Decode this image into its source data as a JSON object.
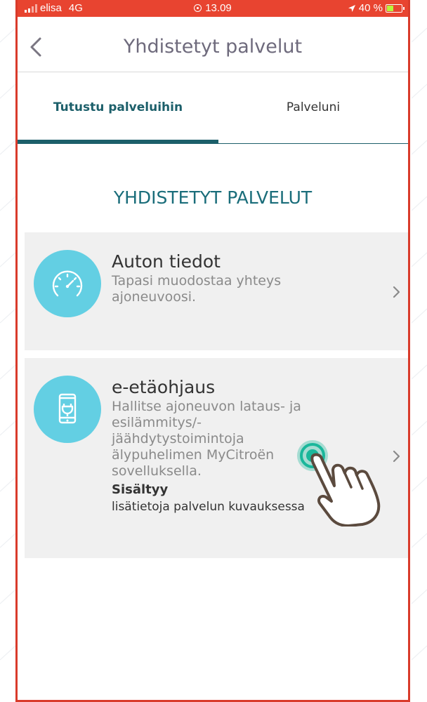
{
  "status_bar": {
    "carrier": "elisa",
    "network": "4G",
    "time": "13.09",
    "battery_percent": "40 %",
    "battery_level": 0.4
  },
  "nav": {
    "title": "Yhdistetyt palvelut"
  },
  "tabs": [
    {
      "label": "Tutustu palveluihin",
      "active": true
    },
    {
      "label": "Palveluni",
      "active": false
    }
  ],
  "section": {
    "title": "YHDISTETYT PALVELUT"
  },
  "cards": [
    {
      "icon": "speedometer-icon",
      "title": "Auton tiedot",
      "description_lines": [
        "Tapasi muodostaa yhteys",
        "ajoneuvoosi."
      ]
    },
    {
      "icon": "phone-plug-icon",
      "title": "e-etäohjaus",
      "description_lines": [
        "Hallitse ajoneuvon lataus- ja",
        "esilämmitys/-",
        "jäähdytystoimintoja",
        "älypuhelimen MyCitroën",
        "sovelluksella."
      ],
      "included_label": "Sisältyy",
      "more_info": "lisätietoja palvelun kuvauksessa"
    }
  ],
  "colors": {
    "status_bar": "#e84430",
    "accent_teal": "#1c5f6a",
    "icon_circle": "#63cfe3",
    "card_bg": "#f0f0f0",
    "tap_indicator": "#1ab79b"
  }
}
